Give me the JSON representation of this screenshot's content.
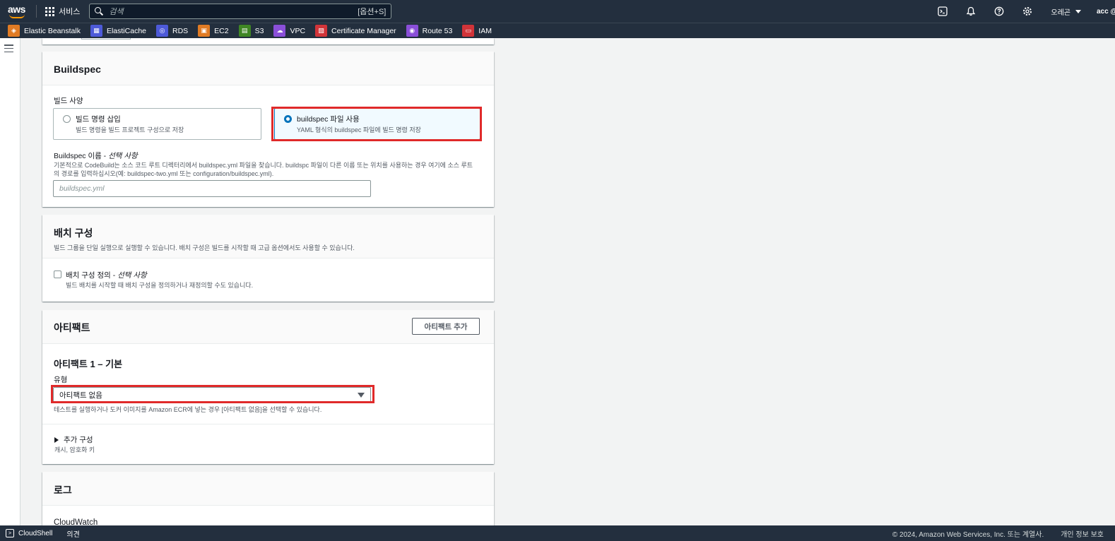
{
  "topnav": {
    "services_label": "서비스",
    "search_placeholder": "검색",
    "search_shortcut": "[옵션+S]",
    "region": "오레곤",
    "account": "acc @"
  },
  "favorites": [
    {
      "label": "Elastic Beanstalk",
      "color": "#e07b24",
      "icon": "beanstalk-icon",
      "glyph": "◈"
    },
    {
      "label": "ElastiCache",
      "color": "#4d5ad8",
      "icon": "elasticache-icon",
      "glyph": "▦"
    },
    {
      "label": "RDS",
      "color": "#4d5ad8",
      "icon": "rds-icon",
      "glyph": "◎"
    },
    {
      "label": "EC2",
      "color": "#e07b24",
      "icon": "ec2-icon",
      "glyph": "▣"
    },
    {
      "label": "S3",
      "color": "#3f8624",
      "icon": "s3-icon",
      "glyph": "▤"
    },
    {
      "label": "VPC",
      "color": "#8a4fd8",
      "icon": "vpc-icon",
      "glyph": "☁"
    },
    {
      "label": "Certificate Manager",
      "color": "#d13439",
      "icon": "certificate-icon",
      "glyph": "▧"
    },
    {
      "label": "Route 53",
      "color": "#8a4fd8",
      "icon": "route53-icon",
      "glyph": "◉"
    },
    {
      "label": "IAM",
      "color": "#d13439",
      "icon": "iam-icon",
      "glyph": "▭"
    }
  ],
  "buildspec": {
    "title": "Buildspec",
    "spec_label": "빌드 사양",
    "option_insert": {
      "label": "빌드 명령 삽입",
      "desc": "빌드 명령을 빌드 프로젝트 구성으로 저장"
    },
    "option_file": {
      "label": "buildspec 파일 사용",
      "desc": "YAML 형식의 buildspec 파일에 빌드 명령 저장"
    },
    "name_label": "Buildspec 이름 - ",
    "name_optional": "선택 사항",
    "name_desc_1": "기본적으로 CodeBuild는 소스 코드 루트 디렉터리에서 buildspec.yml 파일을 찾습니다. buildspc 파일이 다른 이름 또는 위치를 사용하는 경우 여기에 소스 루트",
    "name_desc_2": "의 경로를 입력하십시오(예: buildspec-two.yml 또는 configuration/buildspec.yml).",
    "name_placeholder": "buildspec.yml"
  },
  "batch": {
    "title": "배치 구성",
    "desc": "빌드 그룹을 단일 실행으로 실행할 수 있습니다. 배치 구성은 빌드를 시작할 때 고급 옵션에서도 사용할 수 있습니다.",
    "checkbox_label": "배치 구성 정의 - ",
    "checkbox_optional": "선택 사항",
    "checkbox_desc": "빌드 배치를 시작할 때 배치 구성을 정의하거나 재정의할 수도 있습니다."
  },
  "artifacts": {
    "title": "아티팩트",
    "add_button": "아티팩트 추가",
    "subtitle": "아티팩트 1 – 기본",
    "type_label": "유형",
    "type_value": "아티팩트 없음",
    "type_hint": "테스트를 실행하거나 도커 이미지를 Amazon ECR에 넣는 경우 [아티팩트 없음]을 선택할 수 있습니다.",
    "additional_label": "추가 구성",
    "additional_desc": "캐시, 암호화 키"
  },
  "logs": {
    "title": "로그",
    "cloudwatch": "CloudWatch"
  },
  "footer": {
    "cloudshell": "CloudShell",
    "feedback": "의견",
    "copyright": "© 2024, Amazon Web Services, Inc. 또는 계열사.",
    "privacy": "개인 정보 보호"
  }
}
